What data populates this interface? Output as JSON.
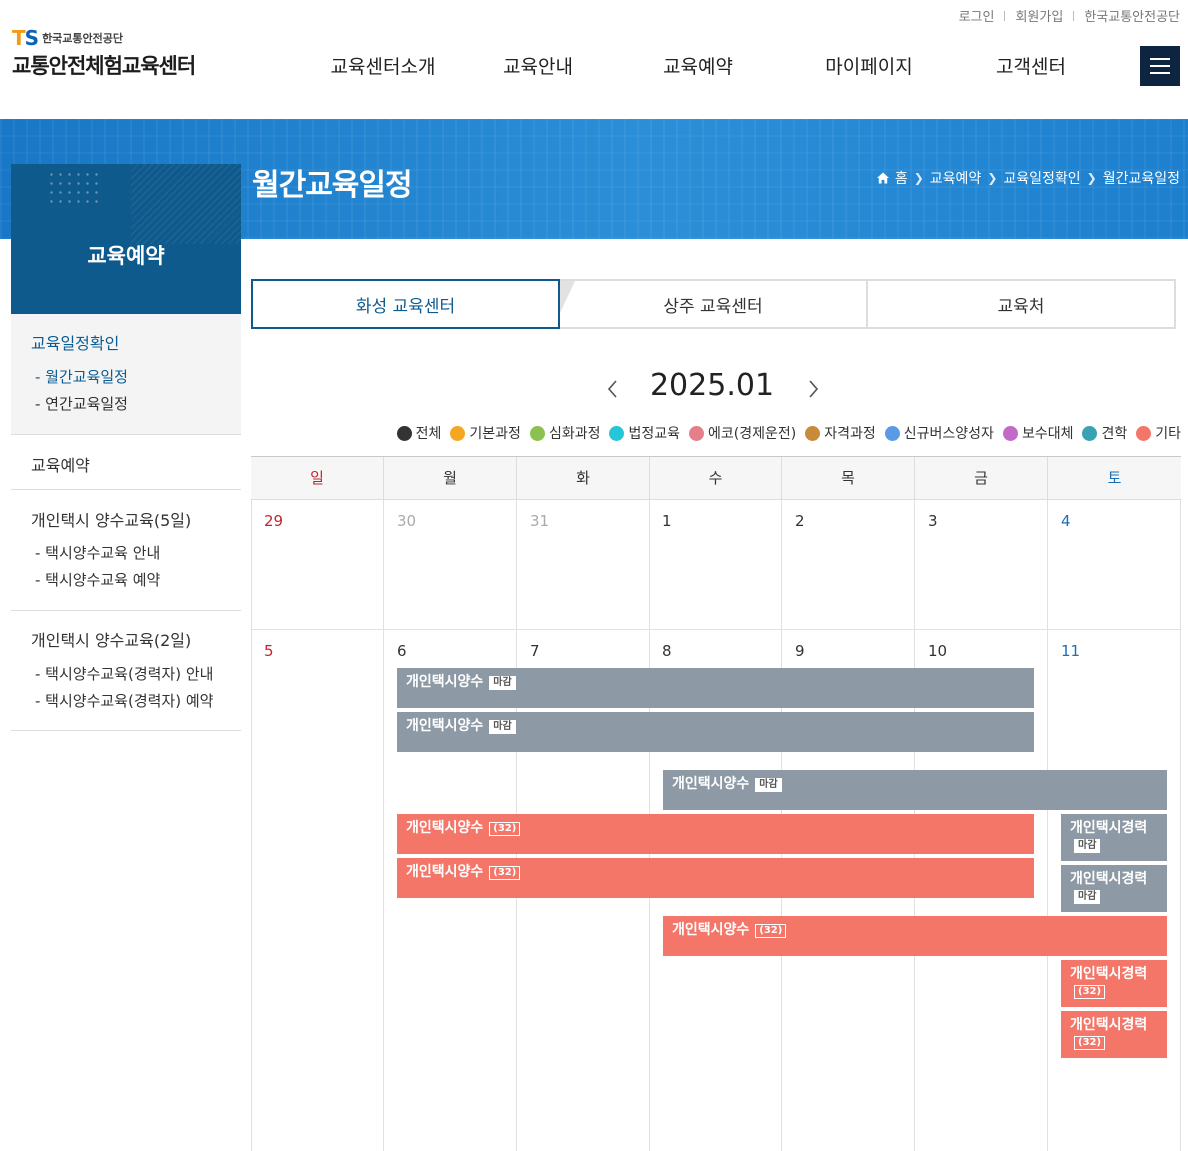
{
  "util_links": [
    "로그인",
    "회원가입",
    "한국교통안전공단"
  ],
  "logo": {
    "ts": "TS",
    "org": "한국교통안전공단",
    "name": "교통안전체험교육센터"
  },
  "gnb": [
    "교육센터소개",
    "교육안내",
    "교육예약",
    "마이페이지",
    "고객센터"
  ],
  "page_title": "월간교육일정",
  "breadcrumb": [
    "홈",
    "교육예약",
    "교육일정확인",
    "월간교육일정"
  ],
  "sidebar": {
    "title": "교육예약",
    "groups": [
      {
        "title": "교육일정확인",
        "items": [
          "- 월간교육일정",
          "- 연간교육일정"
        ]
      },
      {
        "title": "교육예약",
        "items": []
      },
      {
        "title": "개인택시 양수교육(5일)",
        "items": [
          "- 택시양수교육 안내",
          "- 택시양수교육 예약"
        ]
      },
      {
        "title": "개인택시 양수교육(2일)",
        "items": [
          "- 택시양수교육(경력자) 안내",
          "- 택시양수교육(경력자) 예약"
        ]
      }
    ]
  },
  "tabs": [
    "화성 교육센터",
    "상주 교육센터",
    "교육처"
  ],
  "month": "2025.01",
  "legend": [
    {
      "label": "전체",
      "color": "#333333"
    },
    {
      "label": "기본과정",
      "color": "#f5a623"
    },
    {
      "label": "심화과정",
      "color": "#8cc152"
    },
    {
      "label": "법정교육",
      "color": "#26c6da"
    },
    {
      "label": "에코(경제운전)",
      "color": "#e57f8c"
    },
    {
      "label": "자격과정",
      "color": "#c98a3a"
    },
    {
      "label": "신규버스양성자",
      "color": "#5b9be6"
    },
    {
      "label": "보수대체",
      "color": "#c36ac9"
    },
    {
      "label": "견학",
      "color": "#3aa2b3"
    },
    {
      "label": "기타",
      "color": "#f47669"
    }
  ],
  "weekdays": [
    "일",
    "월",
    "화",
    "수",
    "목",
    "금",
    "토"
  ],
  "weeks": [
    [
      "29",
      "30",
      "31",
      "1",
      "2",
      "3",
      "4"
    ],
    [
      "5",
      "6",
      "7",
      "8",
      "9",
      "10",
      "11"
    ]
  ],
  "events": [
    {
      "title": "개인택시양수",
      "tag": "마감",
      "status": "closed"
    },
    {
      "title": "개인택시양수",
      "tag": "마감",
      "status": "closed"
    },
    {
      "title": "개인택시양수",
      "tag": "마감",
      "status": "closed"
    },
    {
      "title": "개인택시양수",
      "tag": "(32)",
      "status": "open"
    },
    {
      "title": "개인택시양수",
      "tag": "(32)",
      "status": "open"
    },
    {
      "title": "개인택시양수",
      "tag": "(32)",
      "status": "open"
    },
    {
      "title": "개인택시경력",
      "tag": "마감",
      "status": "closed"
    },
    {
      "title": "개인택시경력",
      "tag": "마감",
      "status": "closed"
    },
    {
      "title": "개인택시경력",
      "tag": "(32)",
      "status": "open"
    },
    {
      "title": "개인택시경력",
      "tag": "(32)",
      "status": "open"
    }
  ]
}
